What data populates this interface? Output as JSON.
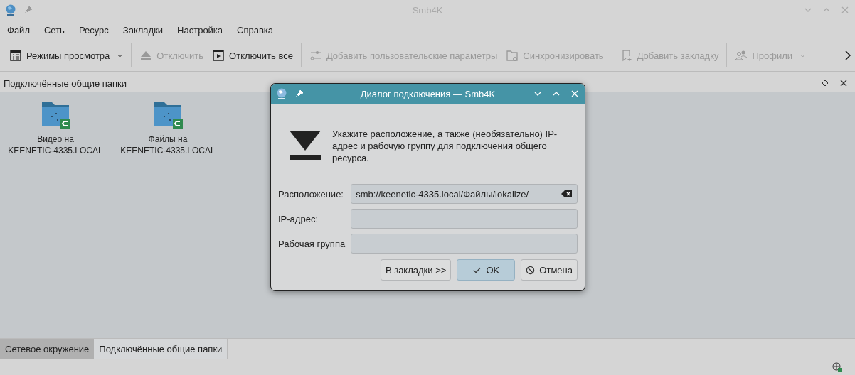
{
  "window": {
    "title": "Smb4K"
  },
  "menu": [
    "Файл",
    "Сеть",
    "Ресурс",
    "Закладки",
    "Настройка",
    "Справка"
  ],
  "toolbar": [
    {
      "label": "Режимы просмотра",
      "disabled": false,
      "dropdown": true
    },
    {
      "label": "Отключить",
      "disabled": true,
      "dropdown": false
    },
    {
      "label": "Отключить все",
      "disabled": false,
      "dropdown": false
    },
    {
      "label": "Добавить пользовательские параметры",
      "disabled": true,
      "dropdown": false
    },
    {
      "label": "Синхронизировать",
      "disabled": true,
      "dropdown": false
    },
    {
      "label": "Добавить закладку",
      "disabled": true,
      "dropdown": false
    },
    {
      "label": "Профили",
      "disabled": true,
      "dropdown": true
    }
  ],
  "panel": {
    "title": "Подключённые общие папки"
  },
  "shares": [
    {
      "lines": [
        "Видео на",
        "KEENETIC-4335.LOCAL"
      ]
    },
    {
      "lines": [
        "Файлы на",
        "KEENETIC-4335.LOCAL"
      ]
    }
  ],
  "tabs": [
    {
      "label": "Сетевое окружение",
      "selected": false
    },
    {
      "label": "Подключённые общие папки",
      "selected": true
    }
  ],
  "dialog": {
    "title": "Диалог подключения — Smb4K",
    "message": "Укажите расположение, а также (необязательно) IP-адрес и рабочую группу для подключения общего ресурса.",
    "fields": [
      {
        "label": "Расположение:",
        "value": "smb://keenetic-4335.local/Файлы/lokalize/",
        "clearable": true
      },
      {
        "label": "IP-адрес:",
        "clearable": false
      },
      {
        "label": "Рабочая группа",
        "clearable": false
      }
    ],
    "buttons": [
      {
        "label": "В закладки >>",
        "kind": "plain"
      },
      {
        "label": "OK",
        "kind": "ok"
      },
      {
        "label": "Отмена",
        "kind": "cancel"
      }
    ]
  }
}
